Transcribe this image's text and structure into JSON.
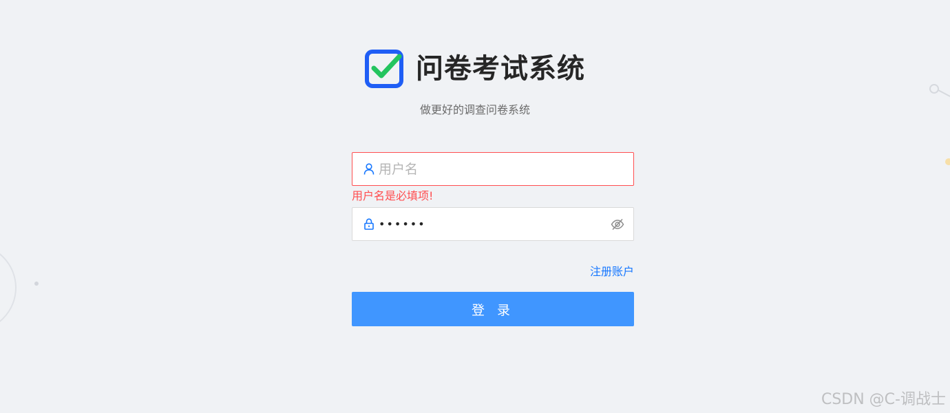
{
  "app": {
    "title": "问卷考试系统",
    "subtitle": "做更好的调查问卷系统",
    "logo_icon": "checkbox-check-icon"
  },
  "form": {
    "username": {
      "value": "",
      "placeholder": "用户名",
      "icon": "user-icon",
      "error": "用户名是必填项!"
    },
    "password": {
      "value": "123456",
      "icon": "lock-icon",
      "toggle_icon": "eye-invisible-icon"
    },
    "register_label": "注册账户",
    "login_label": "登 录"
  },
  "watermark": "CSDN @C-调战士",
  "colors": {
    "background": "#f0f2f5",
    "primary": "#4096ff",
    "link": "#1677ff",
    "error": "#ff4d4f",
    "logo_blue": "#1f5ef5",
    "logo_check": "#23c45e"
  }
}
